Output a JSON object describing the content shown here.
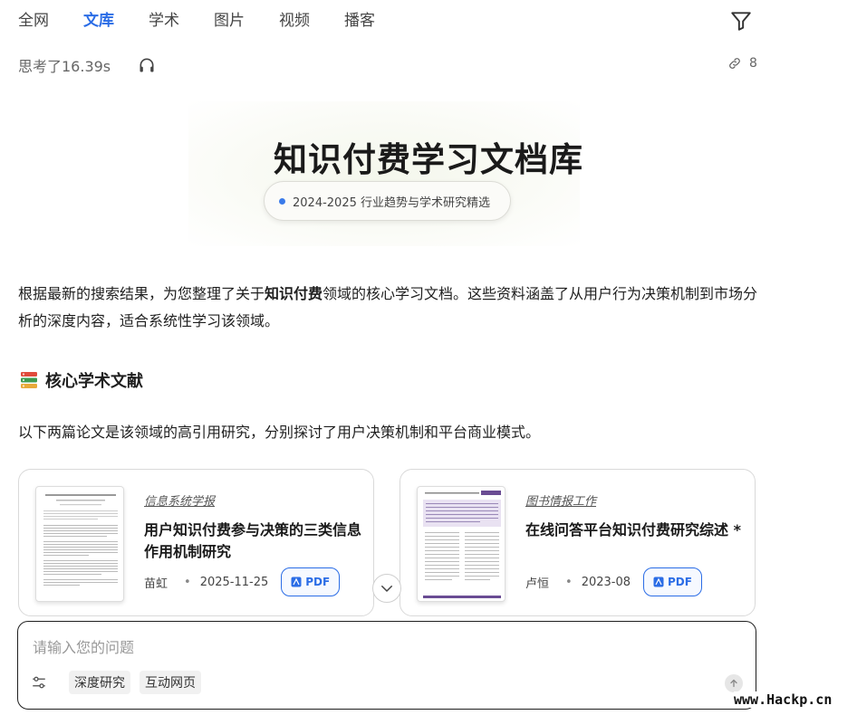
{
  "tabs": [
    {
      "label": "全网"
    },
    {
      "label": "文库"
    },
    {
      "label": "学术"
    },
    {
      "label": "图片"
    },
    {
      "label": "视频"
    },
    {
      "label": "播客"
    }
  ],
  "active_tab": "文库",
  "think_status": "思考了16.39s",
  "source_count": "8",
  "hero": {
    "title": "知识付费学习文档库",
    "subtitle": "2024-2025 行业趋势与学术研究精选"
  },
  "intro": {
    "before": "根据最新的搜索结果，为您整理了关于",
    "bold": "知识付费",
    "after": "领域的核心学习文档。这些资料涵盖了从用户行为决策机制到市场分析的深度内容，适合系统性学习该领域。"
  },
  "section": {
    "title": "核心学术文献",
    "desc": "以下两篇论文是该领域的高引用研究，分别探讨了用户决策机制和平台商业模式。"
  },
  "cards": [
    {
      "journal": "信息系统学报",
      "title": "用户知识付费参与决策的三类信息作用机制研究",
      "author": "苗虹",
      "date": "2025-11-25",
      "pdf_label": "PDF"
    },
    {
      "journal": "图书情报工作",
      "title": "在线问答平台知识付费研究综述 *",
      "author": "卢恒",
      "date": "2023-08",
      "pdf_label": "PDF"
    }
  ],
  "input": {
    "placeholder": "请输入您的问题",
    "chips": [
      "深度研究",
      "互动网页"
    ]
  },
  "watermark": "www.Hackp.cn",
  "colors": {
    "accent": "#2b6de6"
  }
}
